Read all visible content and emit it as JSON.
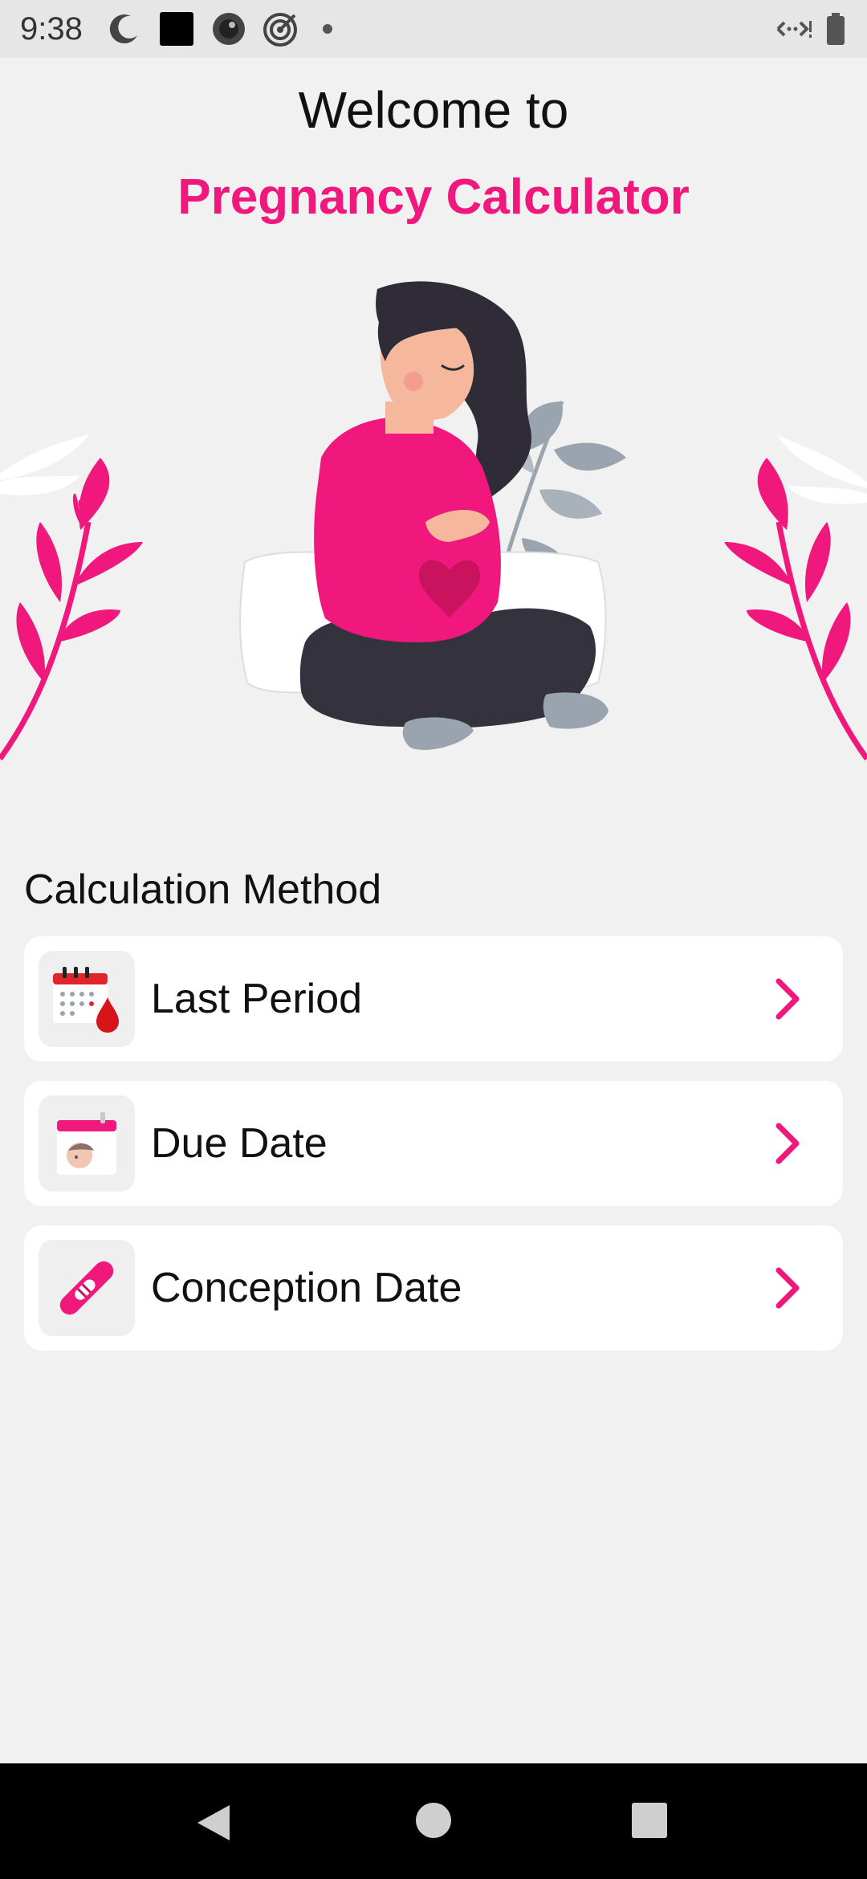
{
  "status_bar": {
    "time": "9:38",
    "icons": [
      "moon-clock-icon",
      "square-icon",
      "circle-record-icon",
      "target-icon",
      "dot-icon"
    ],
    "right_icons": [
      "network-icon",
      "battery-icon"
    ]
  },
  "header": {
    "welcome": "Welcome to",
    "app_name": "Pregnancy Calculator"
  },
  "section": {
    "title": "Calculation Method"
  },
  "methods": [
    {
      "label": "Last Period",
      "icon": "calendar-blood-drop-icon"
    },
    {
      "label": "Due Date",
      "icon": "calendar-baby-icon"
    },
    {
      "label": "Conception Date",
      "icon": "pregnancy-test-icon"
    }
  ],
  "colors": {
    "accent": "#f0177d",
    "background": "#f1f1f1",
    "card": "#ffffff"
  },
  "nav_bar": {
    "buttons": [
      "back-icon",
      "home-icon",
      "recents-icon"
    ]
  }
}
